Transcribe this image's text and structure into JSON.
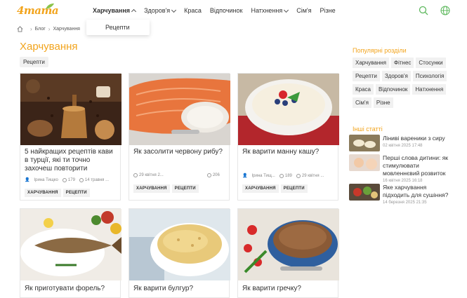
{
  "brand": {
    "logo_text": "4mama"
  },
  "nav": {
    "items": [
      {
        "label": "Харчування",
        "chevron": "up",
        "active": true
      },
      {
        "label": "Здоров'я",
        "chevron": "down"
      },
      {
        "label": "Краса"
      },
      {
        "label": "Відпочинок"
      },
      {
        "label": "Натхнення",
        "chevron": "down"
      },
      {
        "label": "Сім'я"
      },
      {
        "label": "Різне"
      }
    ],
    "dropdown_item": "Рецепти",
    "icons": [
      "search-icon",
      "globe-icon"
    ]
  },
  "breadcrumb": {
    "items": [
      "Блог",
      "Харчування"
    ]
  },
  "page": {
    "title": "Харчування",
    "filter_tag": "Рецепти"
  },
  "cards": [
    {
      "title": "5 найкращих рецептів кави в турції, які ти точно захочеш повторити",
      "author": "Ірина Тищко",
      "views": "179",
      "date": "14 травня ...",
      "tags": [
        "ХАРЧУВАННЯ",
        "РЕЦЕПТИ"
      ]
    },
    {
      "title": "Як засолити червону рибу?",
      "author": "",
      "views": "206",
      "date": "29 квітня 2...",
      "tags": [
        "ХАРЧУВАННЯ",
        "РЕЦЕПТИ"
      ]
    },
    {
      "title": "Як варити манну кашу?",
      "author": "Ірина Тищ...",
      "views": "189",
      "date": "29 квітня ...",
      "tags": [
        "ХАРЧУВАННЯ",
        "РЕЦЕПТИ"
      ]
    },
    {
      "title": "Як приготувати форель?"
    },
    {
      "title": "Як варити булгур?"
    },
    {
      "title": "Як варити гречку?"
    }
  ],
  "sidebar": {
    "popular_title": "Популярні розділи",
    "popular_tags": [
      "Харчування",
      "Фітнес",
      "Стосунки",
      "Рецепти",
      "Здоров'я",
      "Психологія",
      "Краса",
      "Відпочинок",
      "Натхнення",
      "Сім'я",
      "Різне"
    ],
    "other_title": "Інші статті",
    "other_articles": [
      {
        "title": "Ліниві вареники з сиру",
        "date": "02 квітня 2025 17:48"
      },
      {
        "title": "Перші слова дитини: як стимулювати мовленнєвий розвиток",
        "date": "16 квітня 2025 16:18"
      },
      {
        "title": "Яке харчування підходить для сушіння?",
        "date": "14 березня 2025 21:35"
      }
    ]
  },
  "colors": {
    "accent": "#f2a41d",
    "icon_green": "#5cb85c",
    "chip_bg": "#f1f1f1"
  }
}
